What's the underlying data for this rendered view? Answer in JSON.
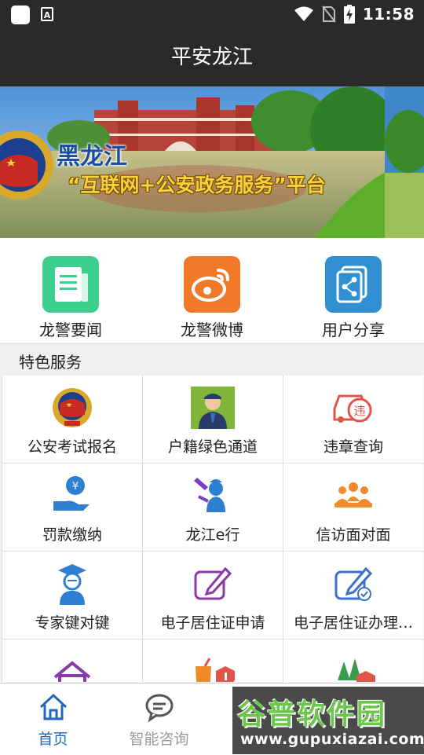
{
  "status_bar": {
    "time": "11:58",
    "notification_badge": "A"
  },
  "app_bar": {
    "title": "平安龙江"
  },
  "banner": {
    "title_line1": "黑龙江",
    "title_line2": "“互联网+公安政务服务”平台"
  },
  "quick_links": [
    {
      "label": "龙警要闻",
      "icon": "news-document-icon",
      "color": "#3ccf8e"
    },
    {
      "label": "龙警微博",
      "icon": "weibo-icon",
      "color": "#f07a2a"
    },
    {
      "label": "用户分享",
      "icon": "share-icon",
      "color": "#2f8fd0"
    }
  ],
  "section": {
    "title": "特色服务"
  },
  "services": [
    {
      "label": "公安考试报名",
      "icon": "police-emblem-icon"
    },
    {
      "label": "户籍绿色通道",
      "icon": "officer-avatar-icon"
    },
    {
      "label": "违章查询",
      "icon": "car-violation-icon"
    },
    {
      "label": "罚款缴纳",
      "icon": "payment-hand-icon"
    },
    {
      "label": "龙江e行",
      "icon": "traffic-police-icon"
    },
    {
      "label": "信访面对面",
      "icon": "meeting-people-icon"
    },
    {
      "label": "专家键对键",
      "icon": "expert-graduate-icon"
    },
    {
      "label": "电子居住证申请",
      "icon": "edit-form-icon"
    },
    {
      "label": "电子居住证办理…",
      "icon": "edit-check-icon"
    },
    {
      "label": "",
      "icon": "house-icon"
    },
    {
      "label": "",
      "icon": "drink-warning-icon"
    },
    {
      "label": "",
      "icon": "forest-fire-icon"
    }
  ],
  "bottom_nav": [
    {
      "label": "首页",
      "icon": "home-icon",
      "active": true
    },
    {
      "label": "智能咨询",
      "icon": "chat-bubble-icon",
      "active": false
    }
  ],
  "watermark": {
    "name": "谷普软件园",
    "url": "www.gupuxiazai.com"
  },
  "colors": {
    "header_bg": "#2a2a2a",
    "active_nav": "#1f67c2",
    "inactive_nav": "#9a9a9a"
  }
}
